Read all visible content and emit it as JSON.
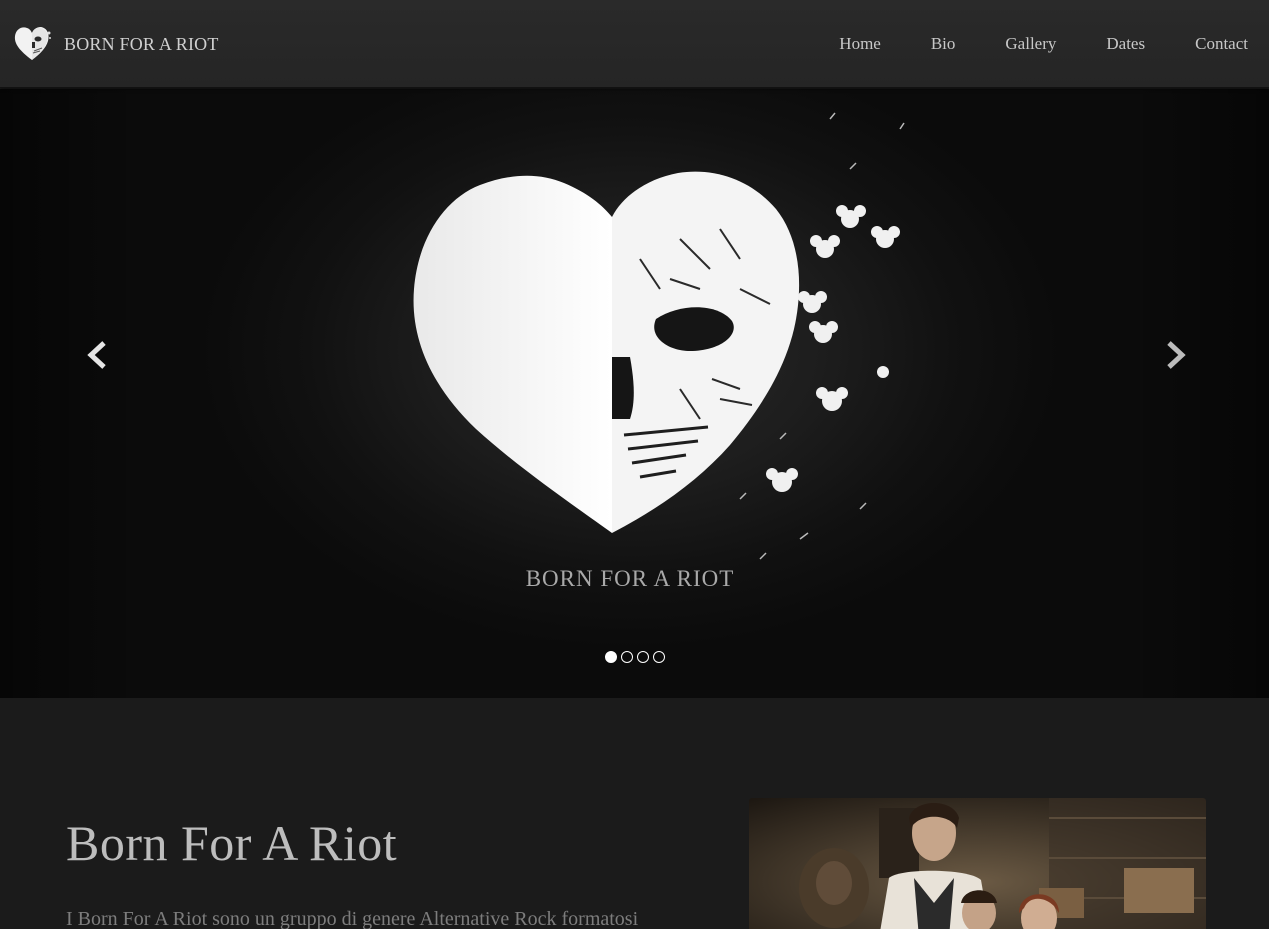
{
  "brand": {
    "name": "BORN FOR A RIOT",
    "logo_icon": "heart-skull-logo-icon"
  },
  "nav": {
    "items": [
      {
        "label": "Home"
      },
      {
        "label": "Bio"
      },
      {
        "label": "Gallery"
      },
      {
        "label": "Dates"
      },
      {
        "label": "Contact"
      }
    ]
  },
  "carousel": {
    "slide_caption": "BORN FOR A RIOT",
    "slide_image_icon": "heart-skull-artwork-icon",
    "prev_icon": "chevron-left-icon",
    "next_icon": "chevron-right-icon",
    "indicator_count": 4,
    "active_index": 0
  },
  "main": {
    "heading": "Born For A Riot",
    "lead": "I Born For A Riot sono un gruppo di genere Alternative Rock formatosi",
    "photo_icon": "band-photo-image"
  },
  "colors": {
    "background": "#1b1b1b",
    "navbar": "#262626",
    "nav_text": "#c8c8c8",
    "heading_text": "#bdbdbd",
    "body_text": "#7d7d7d"
  }
}
